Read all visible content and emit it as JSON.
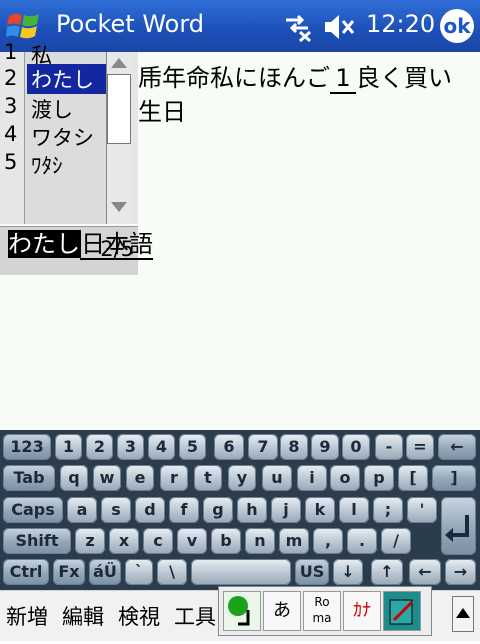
{
  "titlebar": {
    "title": "Pocket Word",
    "clock": "12:20",
    "ok_label": "ok"
  },
  "document": {
    "line1_text": "乕年命私にほんご",
    "line1_underlined": "1",
    "line1_tail": "良く買い",
    "line2_text": "生日"
  },
  "candidates": {
    "numbers": [
      "1",
      "2",
      "3",
      "4",
      "5"
    ],
    "items": [
      "私",
      "わたし",
      "渡し",
      "ワタシ",
      "ﾜﾀｼ"
    ],
    "selected_index": 1,
    "page": "2/5"
  },
  "composing": {
    "selected": "わたし",
    "rest": "日本語"
  },
  "keyboard": {
    "row1": [
      "123",
      "1",
      "2",
      "3",
      "4",
      "5",
      "6",
      "7",
      "8",
      "9",
      "0",
      "-",
      "=",
      "←"
    ],
    "row2": [
      "Tab",
      "q",
      "w",
      "e",
      "r",
      "t",
      "y",
      "u",
      "i",
      "o",
      "p",
      "[",
      "]"
    ],
    "row3": [
      "Caps",
      "a",
      "s",
      "d",
      "f",
      "g",
      "h",
      "j",
      "k",
      "l",
      ";",
      "'"
    ],
    "row4": [
      "Shift",
      "z",
      "x",
      "c",
      "v",
      "b",
      "n",
      "m",
      ",",
      ".",
      "/"
    ],
    "row5": [
      "Ctrl",
      "Fx",
      "áÜ",
      "`",
      "\\",
      "",
      "US",
      "↓",
      "↑",
      "←",
      "→"
    ]
  },
  "menubar": {
    "items": [
      "新増",
      "編輯",
      "検視",
      "工具"
    ]
  },
  "ime": {
    "buttons": [
      "あ",
      "Ro ma",
      "ｶﾅ"
    ]
  }
}
